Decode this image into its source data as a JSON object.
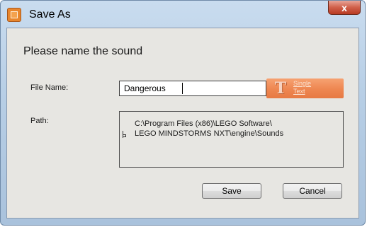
{
  "window": {
    "title": "Save As",
    "close_label": "x"
  },
  "dialog": {
    "heading": "Please name the sound",
    "file_name_label": "File Name:",
    "file_name_value": "Dangerous",
    "single_text_label": "Single\nText",
    "path_label": "Path:",
    "path_line1": "C:\\Program Files (x86)\\LEGO Software\\",
    "path_line2": "LEGO MINDSTORMS NXT\\engine\\Sounds",
    "save_label": "Save",
    "cancel_label": "Cancel"
  },
  "icons": {
    "app": "lego-app-icon",
    "text_tool": "text-t-icon",
    "folder_tree": "folder-tree-icon"
  },
  "colors": {
    "accent_orange": "#ee8650",
    "panel": "#e7e6e2",
    "close_red": "#c74a33"
  }
}
